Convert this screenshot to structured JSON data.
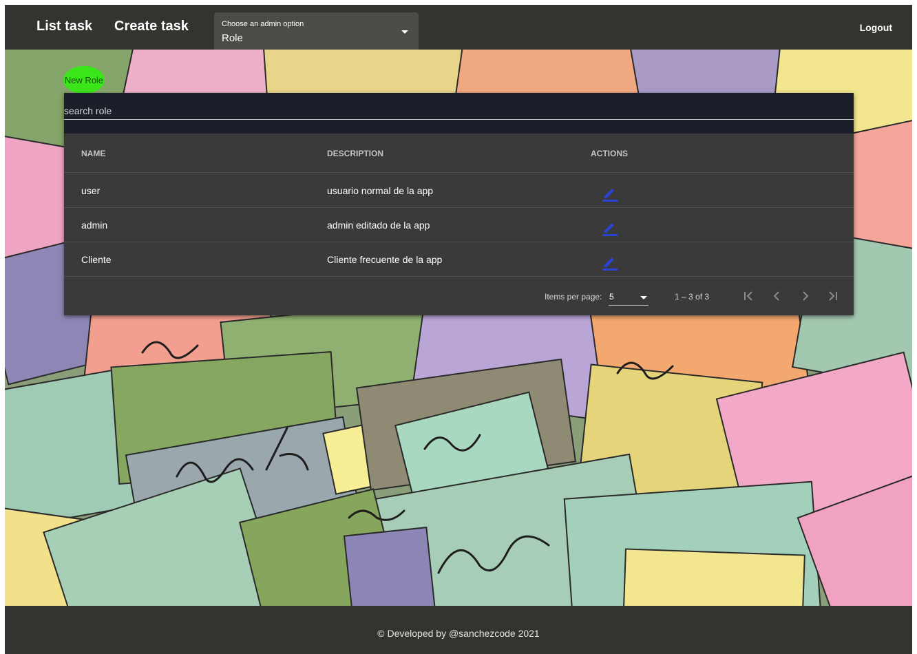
{
  "toolbar": {
    "list_task": "List task",
    "create_task": "Create task",
    "admin_select_label": "Choose an admin option",
    "admin_select_value": "Role",
    "logout": "Logout"
  },
  "new_role_button": "New Role",
  "search": {
    "placeholder": "search role"
  },
  "table": {
    "headers": [
      "NAME",
      "DESCRIPTION",
      "ACTIONS"
    ],
    "rows": [
      {
        "name": "user",
        "description": "usuario normal de la app",
        "action_icon": "edit-icon"
      },
      {
        "name": "admin",
        "description": "admin editado de la app",
        "action_icon": "edit-icon"
      },
      {
        "name": "Cliente",
        "description": "Cliente frecuente de la app",
        "action_icon": "edit-icon"
      }
    ]
  },
  "paginator": {
    "items_per_page_label": "Items per page:",
    "items_per_page_value": "5",
    "range": "1 – 3 of 3",
    "icons": [
      "first-page-icon",
      "previous-page-icon",
      "next-page-icon",
      "last-page-icon"
    ]
  },
  "footer": {
    "text": "© Developed by @sanchezcode 2021"
  },
  "colors": {
    "toolbar_bg": "#323430",
    "card_bg": "#3a3a3a",
    "search_bg": "#1a1f2a",
    "fab_green": "#3ae61a",
    "edit_icon": "#2a45d6"
  }
}
